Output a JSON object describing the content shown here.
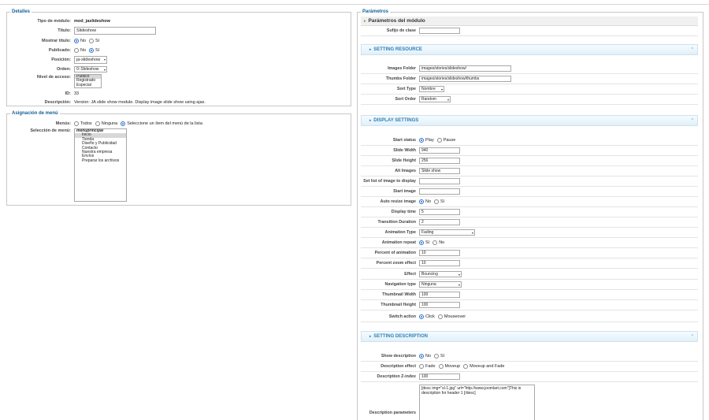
{
  "details": {
    "legend": "Detalles",
    "module_type_label": "Tipo de módulo:",
    "module_type_value": "mod_jaslideshow",
    "title_label": "Título:",
    "title_value": "Slideshow",
    "show_title_label": "Mostrar título:",
    "opt_no": "No",
    "opt_si": "Sí",
    "published_label": "Publicado:",
    "position_label": "Posición:",
    "position_value": "ja-slideshow",
    "order_label": "Orden:",
    "order_value": "0::Slideshow",
    "access_label": "Nivel de acceso:",
    "access_options": [
      "Público",
      "Registrado",
      "Especial"
    ],
    "id_label": "ID:",
    "id_value": "33",
    "description_label": "Descripción:",
    "description_value": "Version: JA slide show module. Display image slide show using ajax."
  },
  "menu": {
    "legend": "Asignación de menú",
    "menus_label": "Menús:",
    "opt_all": "Todos",
    "opt_none": "Ninguna",
    "opt_select": "Seleccione un ítem del menú de la lista",
    "selection_label": "Selección de menú:",
    "items": [
      "menuprincipal",
      "Inicio",
      "Tienda",
      "Diseño y Publicidad",
      "Contacto",
      "Nuestra empresa",
      "Envíos",
      "Preparar los archivos"
    ]
  },
  "params": {
    "legend": "Parámetros",
    "header": "Parámetros del módulo",
    "class_suffix_label": "Sufijo de clase",
    "class_suffix_value": "",
    "resource_title": "SETTING RESOURCE",
    "images_folder_label": "Images Folder",
    "images_folder_value": "images/stories/slideshow/",
    "thumbs_folder_label": "Thumbs Folder",
    "thumbs_folder_value": "images/stories/slideshow/thumbs",
    "sort_type_label": "Sort Type",
    "sort_type_value": "Nombre",
    "sort_order_label": "Sort Order",
    "sort_order_value": "Random",
    "display_title": "DISPLAY SETTINGS",
    "start_status_label": "Start status",
    "opt_play": "Play",
    "opt_pause": "Pause",
    "slide_width_label": "Slide Width",
    "slide_width_value": "940",
    "slide_height_label": "Slide Height",
    "slide_height_value": "256",
    "alt_images_label": "Alt Images",
    "alt_images_value": "Slide show",
    "set_list_label": "Set list of image to display",
    "set_list_value": "",
    "start_image_label": "Start image",
    "start_image_value": "",
    "auto_resize_label": "Auto resize image",
    "opt_no": "No",
    "opt_si": "Sí",
    "display_time_label": "Display time",
    "display_time_value": "5",
    "transition_label": "Transition Duration",
    "transition_value": "2",
    "anim_type_label": "Animation Type",
    "anim_type_value": "Fading",
    "anim_repeat_label": "Animation repeat",
    "percent_anim_label": "Percent of animation",
    "percent_anim_value": "10",
    "percent_zoom_label": "Percent zoom effect",
    "percent_zoom_value": "10",
    "effect_label": "Effect",
    "effect_value": "Bouncing",
    "nav_type_label": "Navigation type",
    "nav_type_value": "Ninguna",
    "thumb_width_label": "Thumbnail Width",
    "thumb_width_value": "100",
    "thumb_height_label": "Thumbnail Height",
    "thumb_height_value": "100",
    "switch_label": "Switch action",
    "opt_click": "Click",
    "opt_mouseover": "Mouseover",
    "description_title": "SETTING DESCRIPTION",
    "show_desc_label": "Show description",
    "desc_effect_label": "Description effect",
    "opt_fade": "Fade",
    "opt_moveup": "Moveup",
    "opt_moveup_fade": "Moveup and Fade",
    "desc_z_label": "Description Z-index",
    "desc_z_value": "100",
    "desc_params_label": "Description parameters",
    "desc_params_value": "[desc img=\"sl-1.jpg\" url=\"http://www.joomlart.com\"]This is description for header 1 [/desc]"
  },
  "colors": {
    "accent": "#146295",
    "section_text": "#2a7fb6",
    "radio": "#2f6fd0"
  }
}
